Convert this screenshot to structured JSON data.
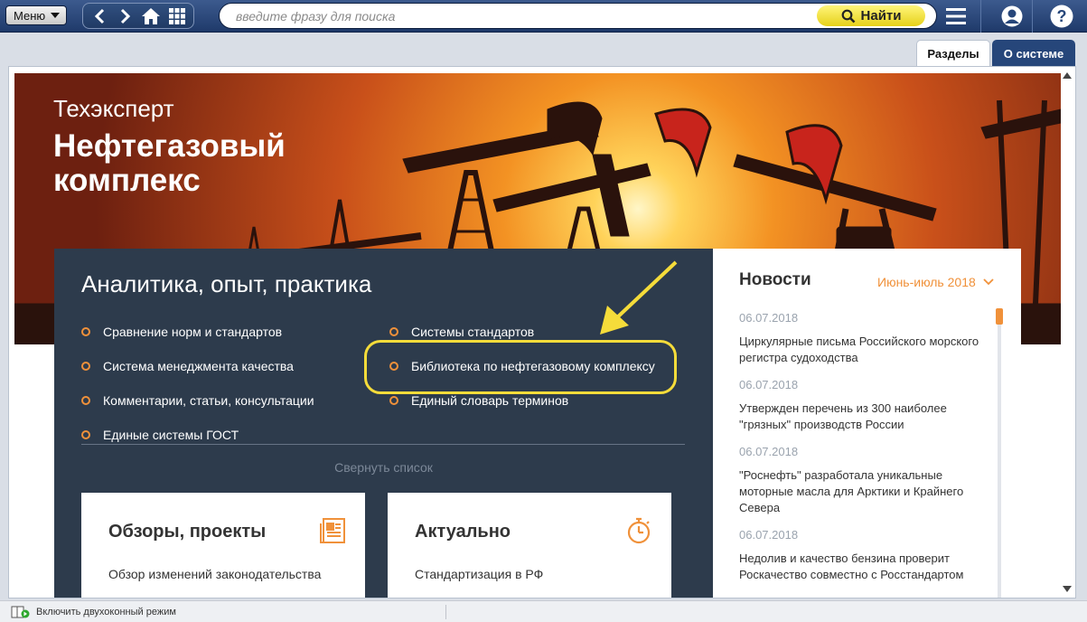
{
  "toolbar": {
    "menu_label": "Меню",
    "search_placeholder": "введите фразу для поиска",
    "search_button": "Найти"
  },
  "tabs": [
    {
      "label": "Разделы",
      "active": true
    },
    {
      "label": "О системе",
      "active": false
    }
  ],
  "hero": {
    "title": "Техэксперт",
    "subtitle": "Нефтегазовый комплекс"
  },
  "analytics": {
    "title": "Аналитика, опыт, практика",
    "left_links": [
      "Сравнение норм и стандартов",
      "Система менеджмента качества",
      "Комментарии, статьи, консультации",
      "Единые системы ГОСТ"
    ],
    "right_links": [
      "Системы стандартов",
      "Библиотека по нефтегазовому комплексу",
      "Единый словарь терминов"
    ],
    "collapse_label": "Свернуть список"
  },
  "cards": [
    {
      "title": "Обзоры, проекты",
      "link": "Обзор изменений законодательства",
      "icon": "document-icon"
    },
    {
      "title": "Актуально",
      "link": "Стандартизация в РФ",
      "icon": "stopwatch-icon"
    }
  ],
  "news": {
    "title": "Новости",
    "period": "Июнь-июль 2018",
    "items": [
      {
        "date": "06.07.2018",
        "text": "Циркулярные письма Российского морского регистра судоходства"
      },
      {
        "date": "06.07.2018",
        "text": "Утвержден перечень из 300 наиболее \"грязных\" производств России"
      },
      {
        "date": "06.07.2018",
        "text": "\"Роснефть\" разработала уникальные моторные масла для Арктики и Крайнего Севера"
      },
      {
        "date": "06.07.2018",
        "text": "Недолив и качество бензина проверит Роскачество совместно с Росстандартом"
      }
    ]
  },
  "status": {
    "dual_window_label": "Включить двухоконный режим"
  },
  "colors": {
    "toolbar": "#26467a",
    "accent": "#f0913a",
    "panel": "#2d3b4c",
    "find_button": "#f5e63a",
    "highlight": "#f5dc3a"
  }
}
